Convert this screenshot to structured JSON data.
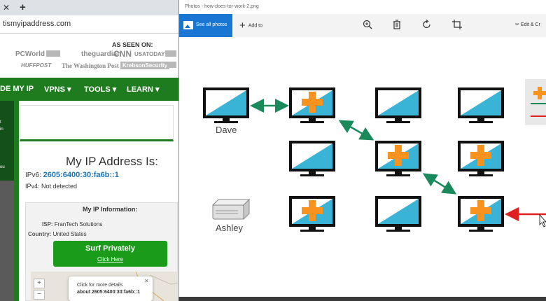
{
  "browser": {
    "tab_close": "✕",
    "tab_new": "+",
    "url": "tismyipaddress.com",
    "as_seen_on": "AS SEEN ON:",
    "logos_row1": [
      "PCWorld",
      "theguardian",
      "CNN",
      "USATODAY"
    ],
    "logos_row2": [
      "HUFFPOST",
      "The Washington Post",
      "KrebsonSecurity"
    ],
    "nav": [
      "DE MY IP",
      "VPNS ▾",
      "TOOLS ▾",
      "LEARN ▾"
    ],
    "side_texts": [
      "t",
      "in",
      "ou"
    ],
    "ip_heading": "My IP Address Is:",
    "ipv6_label": "IPv6:",
    "ipv6_value": "2605:6400:30:fa6b::1",
    "ipv4_label": "IPv4:",
    "ipv4_value": "Not detected",
    "info_title": "My IP Information:",
    "isp_label": "ISP:",
    "isp_value": "FranTech Solutions",
    "country_label": "Country:",
    "country_value": "United States",
    "surf_button": "Surf Privately",
    "surf_link": "Click Here",
    "zoom_in": "+",
    "zoom_out": "−",
    "popup_line1": "Click for more details",
    "popup_line2": "about 2605:6400:30:fa6b::1",
    "popup_close": "✕"
  },
  "photos": {
    "title": "Photos - how-does-tor-work-2.png",
    "see_all": "See all photos",
    "add_to": "Add to",
    "edit_create": "Edit & Cr",
    "labels": {
      "dave": "Dave",
      "ashley": "Ashley"
    },
    "colors": {
      "accent": "#1976d2",
      "green_arrow": "#1a8a5a",
      "red_arrow": "#e02020",
      "tor_plus": "#f7931e",
      "screen": "#3ab4d6"
    }
  }
}
